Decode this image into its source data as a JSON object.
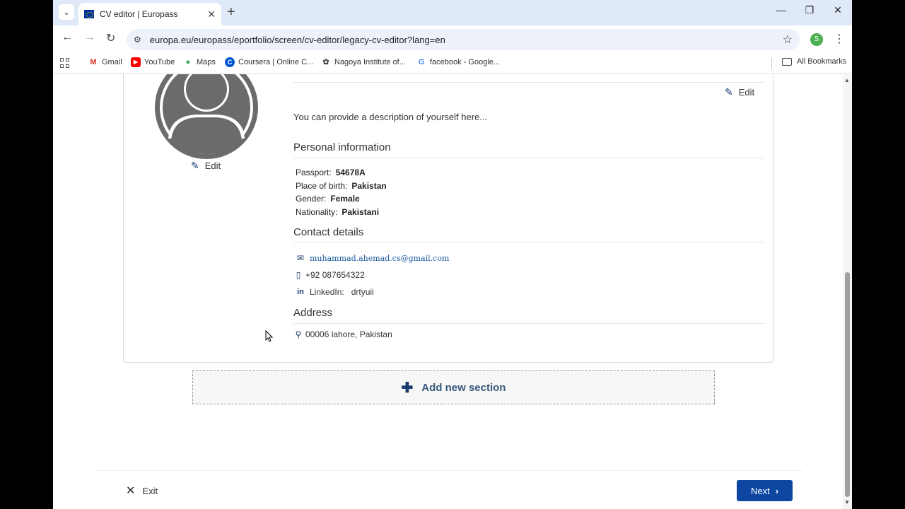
{
  "browser": {
    "tab_title": "CV editor | Europass",
    "url": "europa.eu/europass/eportfolio/screen/cv-editor/legacy-cv-editor?lang=en",
    "profile_initial": "S",
    "bookmarks": [
      {
        "label": "Gmail",
        "icon": "gmail-icon",
        "color": "#d93025",
        "glyph": "M"
      },
      {
        "label": "YouTube",
        "icon": "youtube-icon",
        "color": "#ff0000",
        "glyph": "▶"
      },
      {
        "label": "Maps",
        "icon": "maps-icon",
        "color": "#34a853",
        "glyph": "●"
      },
      {
        "label": "Coursera | Online C...",
        "icon": "coursera-icon",
        "color": "#0056d2",
        "glyph": "C"
      },
      {
        "label": "Nagoya Institute of...",
        "icon": "nagoya-icon",
        "color": "#444444",
        "glyph": "✿"
      },
      {
        "label": "facebook - Google...",
        "icon": "google-icon",
        "color": "#4285f4",
        "glyph": "G"
      }
    ],
    "all_bookmarks": "All Bookmarks"
  },
  "cv": {
    "photo_edit_label": "Edit",
    "about_edit_label": "Edit",
    "description": "You can provide a description of yourself here...",
    "personal_info": {
      "title": "Personal information",
      "fields": [
        {
          "label": "Passport:",
          "value": "54678A"
        },
        {
          "label": "Place of birth:",
          "value": "Pakistan"
        },
        {
          "label": "Gender:",
          "value": "Female"
        },
        {
          "label": "Nationality:",
          "value": "Pakistani"
        }
      ]
    },
    "contact": {
      "title": "Contact details",
      "email": "muhammad.ahemad.cs@gmail.com",
      "phone": "+92 087654322",
      "linkedin_label": "LinkedIn:",
      "linkedin_value": "drtyuii"
    },
    "address": {
      "title": "Address",
      "value": "00006 lahore, Pakistan"
    }
  },
  "actions": {
    "add_section": "Add new section",
    "exit": "Exit",
    "next": "Next"
  },
  "colors": {
    "primary": "#0e47a1",
    "icon": "#1a3a6e"
  }
}
